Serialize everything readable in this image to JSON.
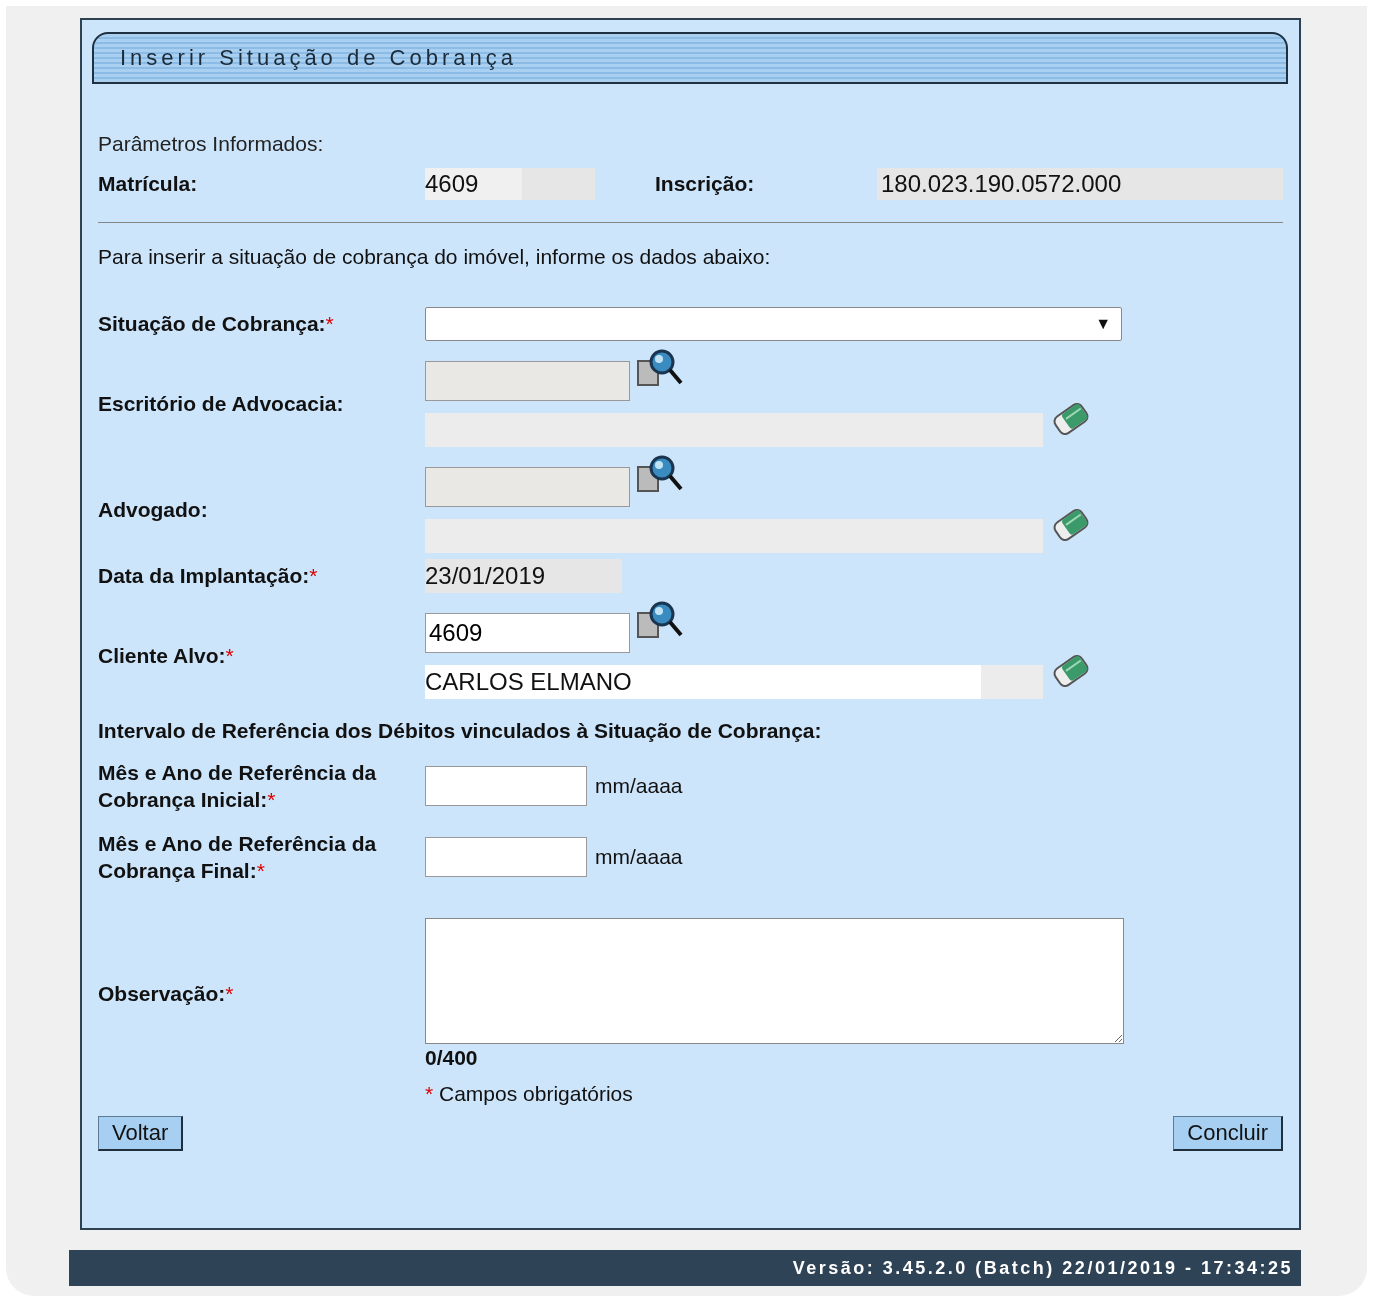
{
  "title": "Inserir Situação de Cobrança",
  "params": {
    "heading": "Parâmetros Informados:",
    "fields": [
      {
        "label": "Matrícula:",
        "value": "4609"
      },
      {
        "label": "Inscrição:",
        "value": "180.023.190.0572.000"
      }
    ]
  },
  "instruction": "Para inserir a situação de cobrança do imóvel, informe os dados abaixo:",
  "rows": [
    {
      "kind": "select",
      "label": "Situação de Cobrança:",
      "mark": "*",
      "arrow": "▼"
    },
    {
      "kind": "lookup",
      "label": "Escritório de Advocacia:",
      "disabled": true
    },
    {
      "kind": "lookup",
      "label": "Advogado:",
      "disabled": true
    },
    {
      "kind": "readonly",
      "label": "Data da Implantação:",
      "mark": "*",
      "value": "23/01/2019"
    },
    {
      "kind": "lookup",
      "label": "Cliente Alvo:",
      "mark": "*",
      "disabled": false,
      "code": "4609",
      "description": "CARLOS ELMANO"
    },
    {
      "kind": "heading",
      "label": "Intervalo de Referência dos Débitos vinculados à Situação de Cobrança:"
    },
    {
      "kind": "month",
      "label": "Mês e Ano de Referência da Cobrança Inicial:",
      "mark": "*",
      "hint": "mm/aaaa"
    },
    {
      "kind": "month",
      "label": "Mês e Ano de Referência da Cobrança Final:",
      "mark": "*",
      "hint": "mm/aaaa"
    },
    {
      "kind": "textarea",
      "label": "Observação:",
      "mark": "*",
      "counter": "0/400"
    }
  ],
  "legend": {
    "mark": "*",
    "text": "Campos obrigatórios"
  },
  "buttons": {
    "back": "Voltar",
    "finish": "Concluir"
  },
  "footer": "Versão: 3.45.2.0 (Batch) 22/01/2019 - 17:34:25"
}
